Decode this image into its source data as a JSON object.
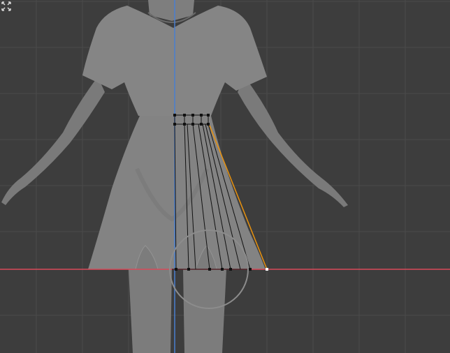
{
  "viewport": {
    "background": "#3d3d3d",
    "grid_color": "#4a4a4a",
    "axis_x_color": "#d94a5a",
    "axis_z_color": "#4a7fd0",
    "figure_fill": "#7a7a7a",
    "figure_shade": "#6a6a6a",
    "selected_edge_color": "#e8920f",
    "wire_color": "#111111",
    "vertex_color": "#111111",
    "brush_circle_color": "#8c8c8c"
  },
  "icons": {
    "corner": "toggle-maximize-icon"
  }
}
